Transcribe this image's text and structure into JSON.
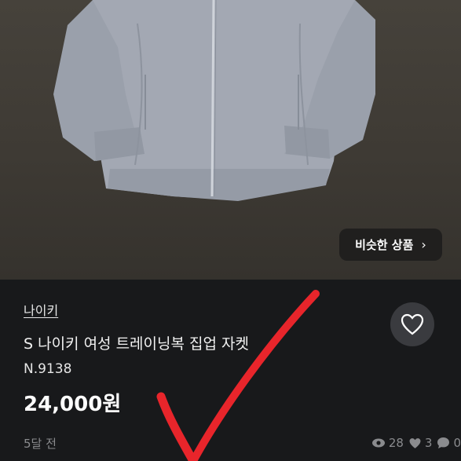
{
  "photo": {
    "icon": "jacket-photo"
  },
  "similar_button": {
    "label": "비슷한 상품",
    "chevron": "›"
  },
  "product": {
    "brand": "나이키",
    "title": "S 나이키 여성 트레이닝복 집업 자켓",
    "code": "N.9138",
    "price": "24,000원",
    "posted": "5달 전"
  },
  "stats": {
    "views": "28",
    "likes": "3",
    "chats": "0"
  },
  "colors": {
    "background": "#18191b",
    "check_mark": "#e8252b"
  }
}
